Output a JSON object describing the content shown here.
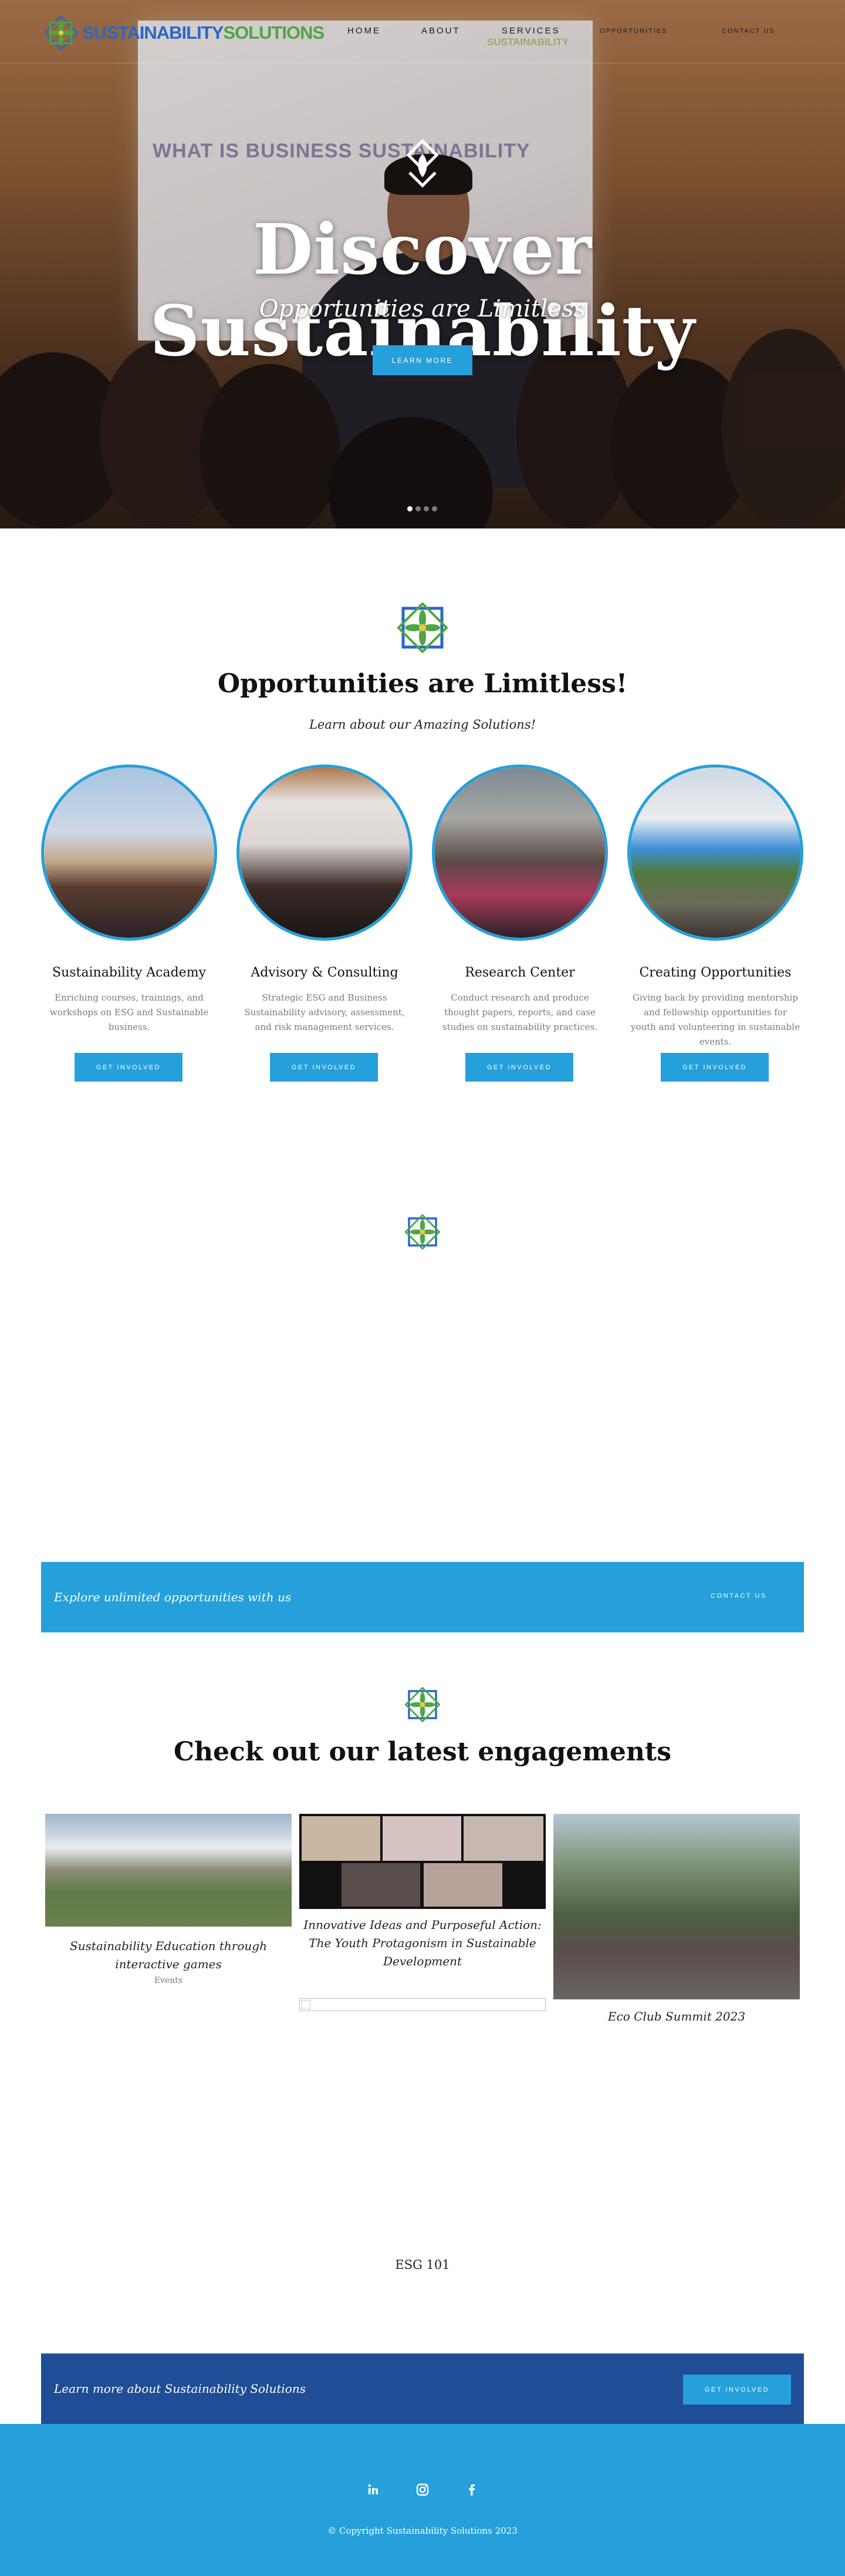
{
  "brand": {
    "name_part1": "SUSTAINABILITY",
    "name_part2": "SOLUTIONS",
    "primary_color": "#26a0da",
    "dark_color": "#1f4e96",
    "logo_blue": "#2a67c8",
    "logo_green": "#4ea544"
  },
  "nav": {
    "items": [
      "HOME",
      "ABOUT",
      "SERVICES",
      "OPPORTUNITIES",
      "CONTACT US"
    ]
  },
  "hero": {
    "screen_text": "WHAT IS BUSINESS SUSTAINABILITY",
    "screen_logo_text": "SUSTAINABILITY",
    "title": "Discover Sustainability",
    "subtitle": "Opportunities are Limitless",
    "button": "LEARN MORE",
    "slides": 4,
    "active_slide": 1
  },
  "services_section": {
    "title": "Opportunities are Limitless!",
    "subtitle": "Learn about our Amazing Solutions!",
    "items": [
      {
        "title": "Sustainability Academy",
        "text": "Enriching courses, trainings, and workshops on ESG and Sustainable business.",
        "button": "GET INVOLVED"
      },
      {
        "title": "Advisory & Consulting",
        "text": "Strategic ESG and Business Sustainability advisory, assessment, and risk management services.",
        "button": "GET INVOLVED"
      },
      {
        "title": "Research Center",
        "text": "Conduct research and produce thought papers, reports, and case studies on sustainability practices.",
        "button": "GET INVOLVED"
      },
      {
        "title": "Creating Opportunities",
        "text": "Giving back by providing mentorship and fellowship opportunities for youth and volunteering in sustainable events.",
        "button": "GET INVOLVED"
      }
    ]
  },
  "contact_banner": {
    "text": "Explore unlimited opportunities with us",
    "button": "CONTACT US"
  },
  "engagements": {
    "title": "Check out our latest engagements",
    "posts": [
      {
        "caption": "Sustainability Education through interactive games",
        "meta": "Events"
      },
      {
        "caption": "Innovative Ideas and Purposeful Action: The Youth Protagonism in Sustainable Development",
        "meta": ""
      },
      {
        "caption": "Eco Club Summit 2023",
        "meta": ""
      }
    ],
    "extra": "ESG 101"
  },
  "cta_banner": {
    "text": "Learn more about Sustainability Solutions",
    "button": "GET INVOLVED"
  },
  "footer": {
    "social": [
      "linkedin-icon",
      "instagram-icon",
      "facebook-icon"
    ],
    "copyright": "© Copyright Sustainability Solutions 2023"
  }
}
